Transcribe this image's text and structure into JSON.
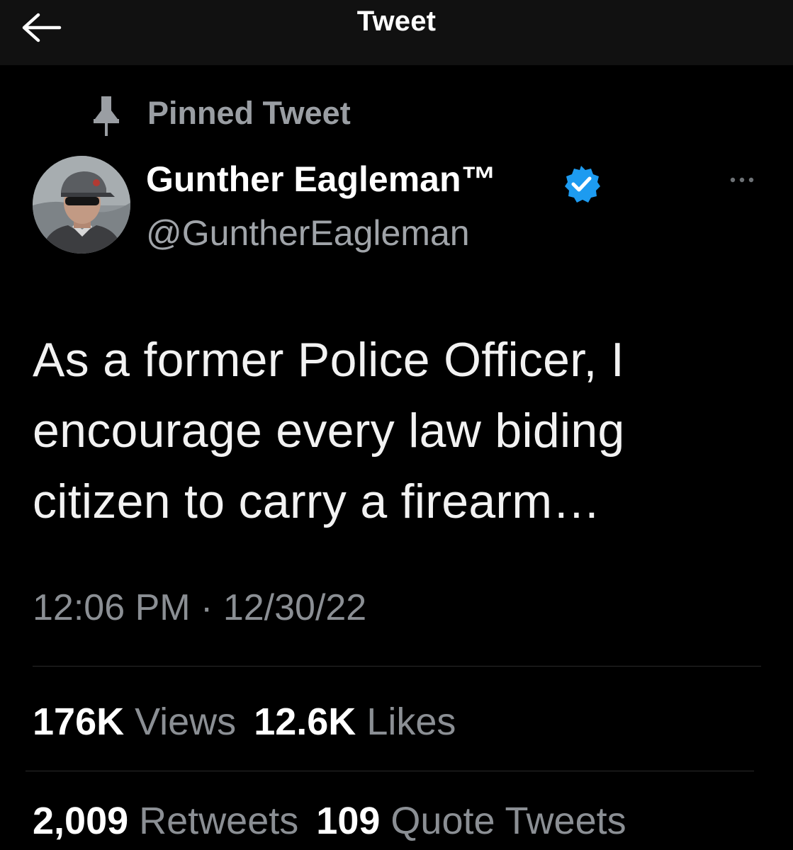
{
  "header": {
    "title": "Tweet",
    "back_icon": "arrow-left-icon"
  },
  "pinned": {
    "icon": "pin-icon",
    "label": "Pinned Tweet"
  },
  "author": {
    "display_name": "Gunther Eagleman™",
    "handle": "@GuntherEagleman",
    "verified": true,
    "verified_icon": "verified-badge-icon"
  },
  "tweet": {
    "lines": [
      "As a former Police Officer, I",
      "encourage every law biding",
      "citizen to carry a firearm…"
    ],
    "time": "12:06 PM",
    "separator": "·",
    "date": "12/30/22"
  },
  "stats": {
    "views_count": "176K",
    "views_label": "Views",
    "likes_count": "12.6K",
    "likes_label": "Likes",
    "retweets_count": "2,009",
    "retweets_label": "Retweets",
    "quotes_count": "109",
    "quotes_label": "Quote Tweets"
  },
  "colors": {
    "background": "#000000",
    "header_background": "#111111",
    "primary_text": "#ffffff",
    "secondary_text": "#8b8f94",
    "verified_blue": "#1d9bf0"
  }
}
